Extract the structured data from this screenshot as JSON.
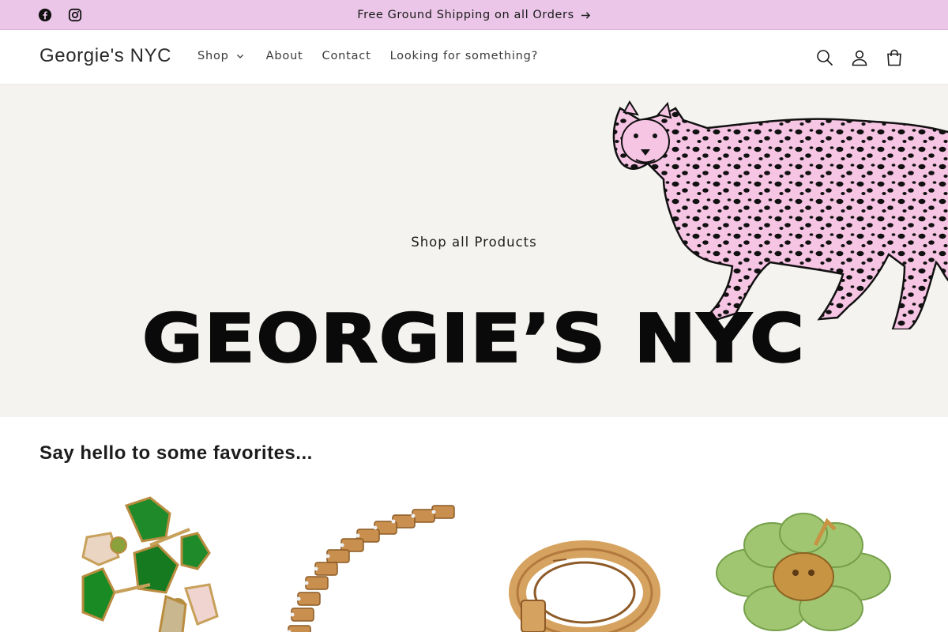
{
  "announcement": {
    "text": "Free Ground Shipping on all Orders",
    "bg_color": "#ebc6e8",
    "social": [
      {
        "icon": "facebook-icon"
      },
      {
        "icon": "instagram-icon"
      }
    ]
  },
  "header": {
    "logo": "Georgie's NYC",
    "nav": [
      {
        "label": "Shop",
        "has_dropdown": true
      },
      {
        "label": "About"
      },
      {
        "label": "Contact"
      },
      {
        "label": "Looking for something?"
      }
    ],
    "icons": [
      "search-icon",
      "account-icon",
      "cart-icon"
    ]
  },
  "hero": {
    "cta": "Shop all Products",
    "title": "GEORGIE’S NYC",
    "bg_color": "#f4f3ef",
    "accent_color": "#f7c5e4"
  },
  "favorites": {
    "heading": "Say hello to some favorites...",
    "products": [
      {
        "image": "green-crystal-brooch"
      },
      {
        "image": "gold-link-bracelet"
      },
      {
        "image": "gold-buckle-ring"
      },
      {
        "image": "green-glass-flower-brooch"
      }
    ]
  }
}
